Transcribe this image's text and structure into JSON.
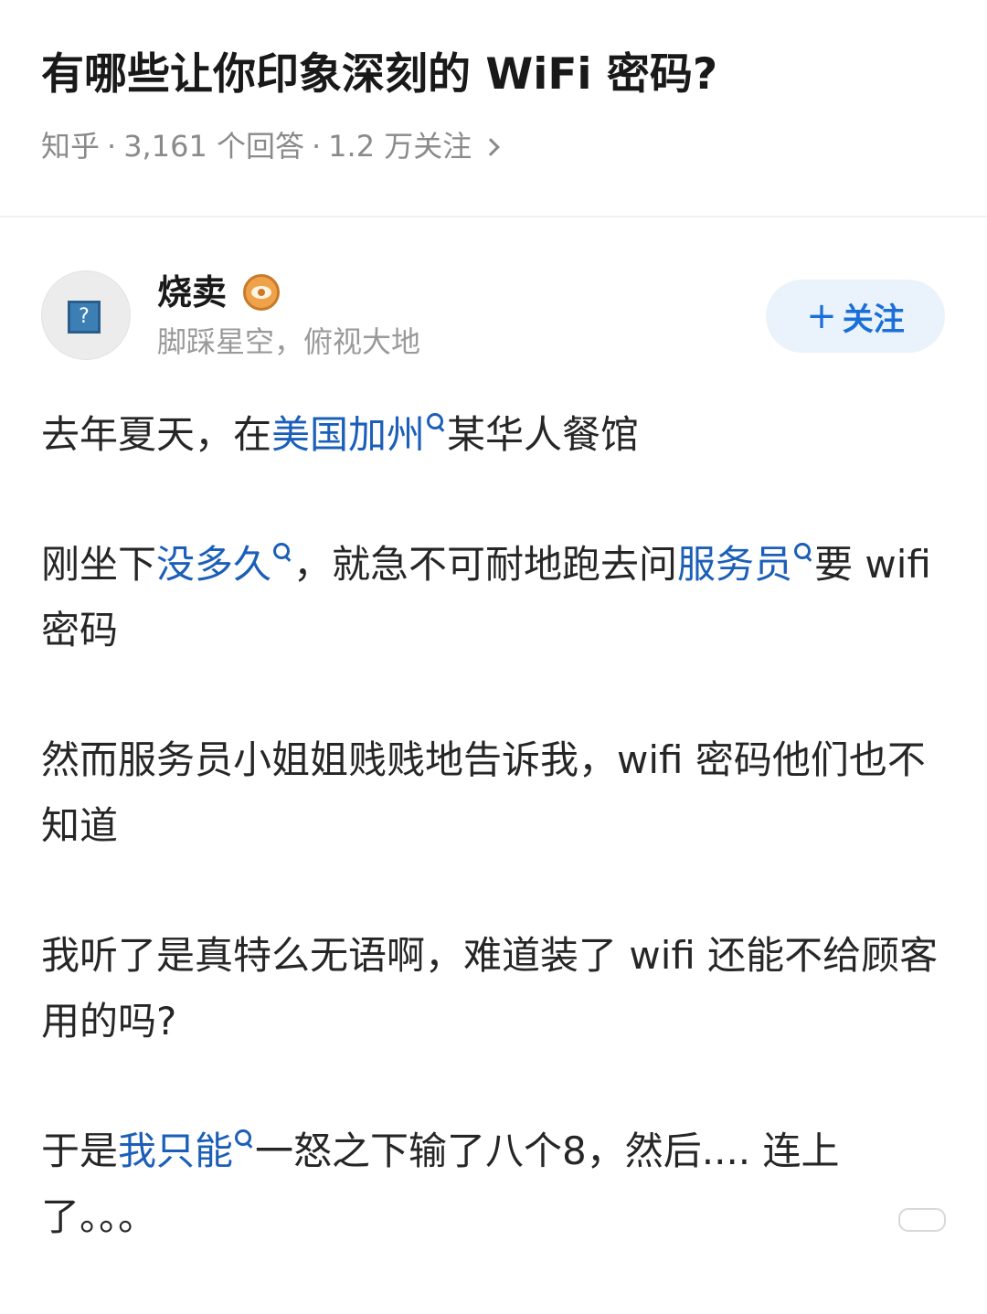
{
  "question": {
    "title": "有哪些让你印象深刻的 WiFi 密码?",
    "source": "知乎",
    "answers": "3,161 个回答",
    "followers": "1.2 万关注",
    "sep": "·"
  },
  "author": {
    "name": "烧卖",
    "bio": "脚踩星空，俯视大地",
    "follow_plus": "+",
    "follow_label": "关注",
    "avatar_glyph": "?"
  },
  "answer": {
    "p1": {
      "a": "去年夏天，在",
      "kw1": "美国加州",
      "b": "某华人餐馆"
    },
    "p2": {
      "a": "刚坐下",
      "kw1": "没多久",
      "b": "，就急不可耐地跑去问",
      "kw2": "服务员",
      "c": "要 wifi 密码"
    },
    "p3": "然而服务员小姐姐贱贱地告诉我，wifi 密码他们也不知道",
    "p4": "我听了是真特么无语啊，难道装了 wifi 还能不给顾客用的吗?",
    "p5": {
      "a": "于是",
      "kw1": "我只能",
      "b": "一怒之下输了八个8，然后.... 连上了。。。"
    }
  },
  "colors": {
    "keyword": "#1b5fb8",
    "follow_text": "#1b6fd8",
    "follow_bg": "#eaf2fb",
    "meta": "#8a8a8a"
  },
  "icons": {
    "chevron": "chevron-right-icon",
    "search": "search-icon",
    "badge": "eye-badge-icon",
    "avatar": "avatar-placeholder-icon"
  }
}
